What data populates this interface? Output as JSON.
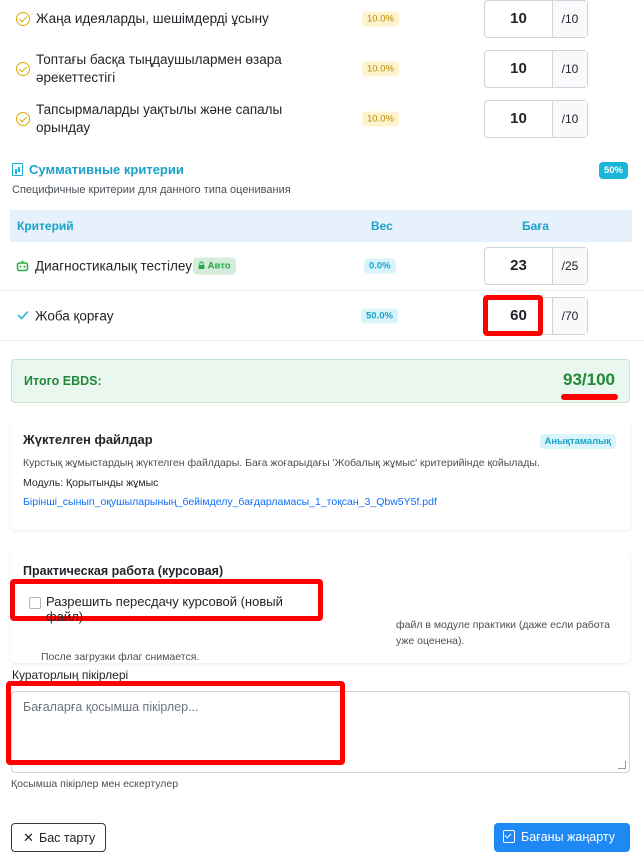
{
  "criteria": [
    {
      "label": "Жаңа идеяларды, шешімдерді ұсыну",
      "weight": "10.0%",
      "score": "10",
      "max": "/10"
    },
    {
      "label": "Топтағы басқа тыңдаушылармен өзара әрекеттестігі",
      "weight": "10.0%",
      "score": "10",
      "max": "/10"
    },
    {
      "label": "Тапсырмаларды уақтылы және сапалы орындау",
      "weight": "10.0%",
      "score": "10",
      "max": "/10"
    }
  ],
  "summative": {
    "title": "Суммативные критерии",
    "percent": "50%",
    "description": "Специфичные критерии для данного типа оценивания",
    "headers": {
      "criterion": "Критерий",
      "weight": "Вес",
      "grade": "Баға"
    },
    "rows": [
      {
        "label": "Диагностикалық тестілеу",
        "auto_badge": "Авто",
        "weight": "0.0%",
        "score": "23",
        "max": "/25"
      },
      {
        "label": "Жоба қорғау",
        "weight": "50.0%",
        "score": "60",
        "max": "/70"
      }
    ]
  },
  "total": {
    "label": "Итого EBDS:",
    "value": "93/100"
  },
  "files": {
    "title": "Жүктелген файлдар",
    "badge": "Анықтамалық",
    "description": "Курстық жұмыстардың жүктелген файлдары. Баға жоғарыдағы 'Жобалық жұмыс' критерийінде қойылады.",
    "module": "Модуль: Қорытынды жұмыс",
    "link": "Бірінші_сынып_оқушыларының_бейімделу_бағдарламасы_1_тоқсан_3_Qbw5Y5f.pdf"
  },
  "practical": {
    "title": "Практическая работа (курсовая)",
    "checkbox_label": "Разрешить пересдачу курсовой (новый файл)",
    "desc_line1": "файл в модуле практики (даже если работа уже оценена).",
    "desc_line2": "После загрузки флаг снимается."
  },
  "comments": {
    "label": "Кураторлың пікірлері",
    "placeholder": "Бағаларға қосымша пікірлер...",
    "hint": "Қосымша пікірлер мен ескертулер"
  },
  "buttons": {
    "cancel": "Бас тарту",
    "update": "Бағаны жаңарту"
  },
  "colors": {
    "accent": "#1bb5d8",
    "primary": "#1e88f5",
    "success": "#218838",
    "highlight": "#ff0000"
  }
}
